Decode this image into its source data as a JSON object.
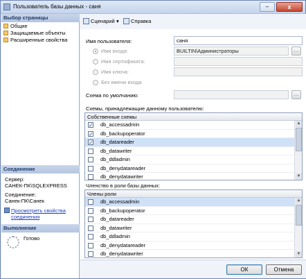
{
  "window": {
    "title": "Пользователь базы данных - саня",
    "minimize": "–",
    "close": "x"
  },
  "left_pane": {
    "select_page_header": "Выбор страницы",
    "pages": [
      "Общие",
      "Защищаемые объекты",
      "Расширенные свойства"
    ],
    "connection_header": "Соединение",
    "server_label": "Сервер:",
    "server_value": "САНЕК-ПК\\SQLEXPRESS",
    "conn_label": "Соединение:",
    "conn_value": "Санек-ПК\\Санек",
    "view_props_link_1": "Просмотреть свойства",
    "view_props_link_2": "соединения",
    "progress_header": "Выполнение",
    "status": "Готово"
  },
  "toolbar": {
    "script": "Сценарий",
    "dropdown": "▾",
    "help": "Справка"
  },
  "form": {
    "username_label": "Имя пользователя:",
    "username_value": "саня",
    "login_name": "Имя входа:",
    "login_value": "BUILTIN\\Администраторы",
    "cert_name": "Имя сертификата:",
    "key_name": "Имя ключа:",
    "no_login": "Без имени входа",
    "default_schema": "Схема по умолчанию:",
    "browse": "..."
  },
  "owned_schemas": {
    "label": "Схемы, принадлежащие данному пользователю:",
    "header": "Собственные схемы",
    "items": [
      {
        "name": "db_accessadmin",
        "checked": true
      },
      {
        "name": "db_backupoperator",
        "checked": true
      },
      {
        "name": "db_datareader",
        "checked": true
      },
      {
        "name": "db_datawriter",
        "checked": false
      },
      {
        "name": "db_ddladmin",
        "checked": false
      },
      {
        "name": "db_denydatareader",
        "checked": false
      },
      {
        "name": "db_denydatawriter",
        "checked": false
      }
    ]
  },
  "role_membership": {
    "label": "Членство в роли базы данных:",
    "header": "Члены роли",
    "items": [
      {
        "name": "db_accessadmin",
        "checked": false
      },
      {
        "name": "db_backupoperator",
        "checked": false
      },
      {
        "name": "db_datareader",
        "checked": false
      },
      {
        "name": "db_datawriter",
        "checked": false
      },
      {
        "name": "db_ddladmin",
        "checked": false
      },
      {
        "name": "db_denydatareader",
        "checked": false
      },
      {
        "name": "db_denydatawriter",
        "checked": false
      }
    ]
  },
  "buttons": {
    "ok": "ОК",
    "cancel": "Отмена"
  }
}
